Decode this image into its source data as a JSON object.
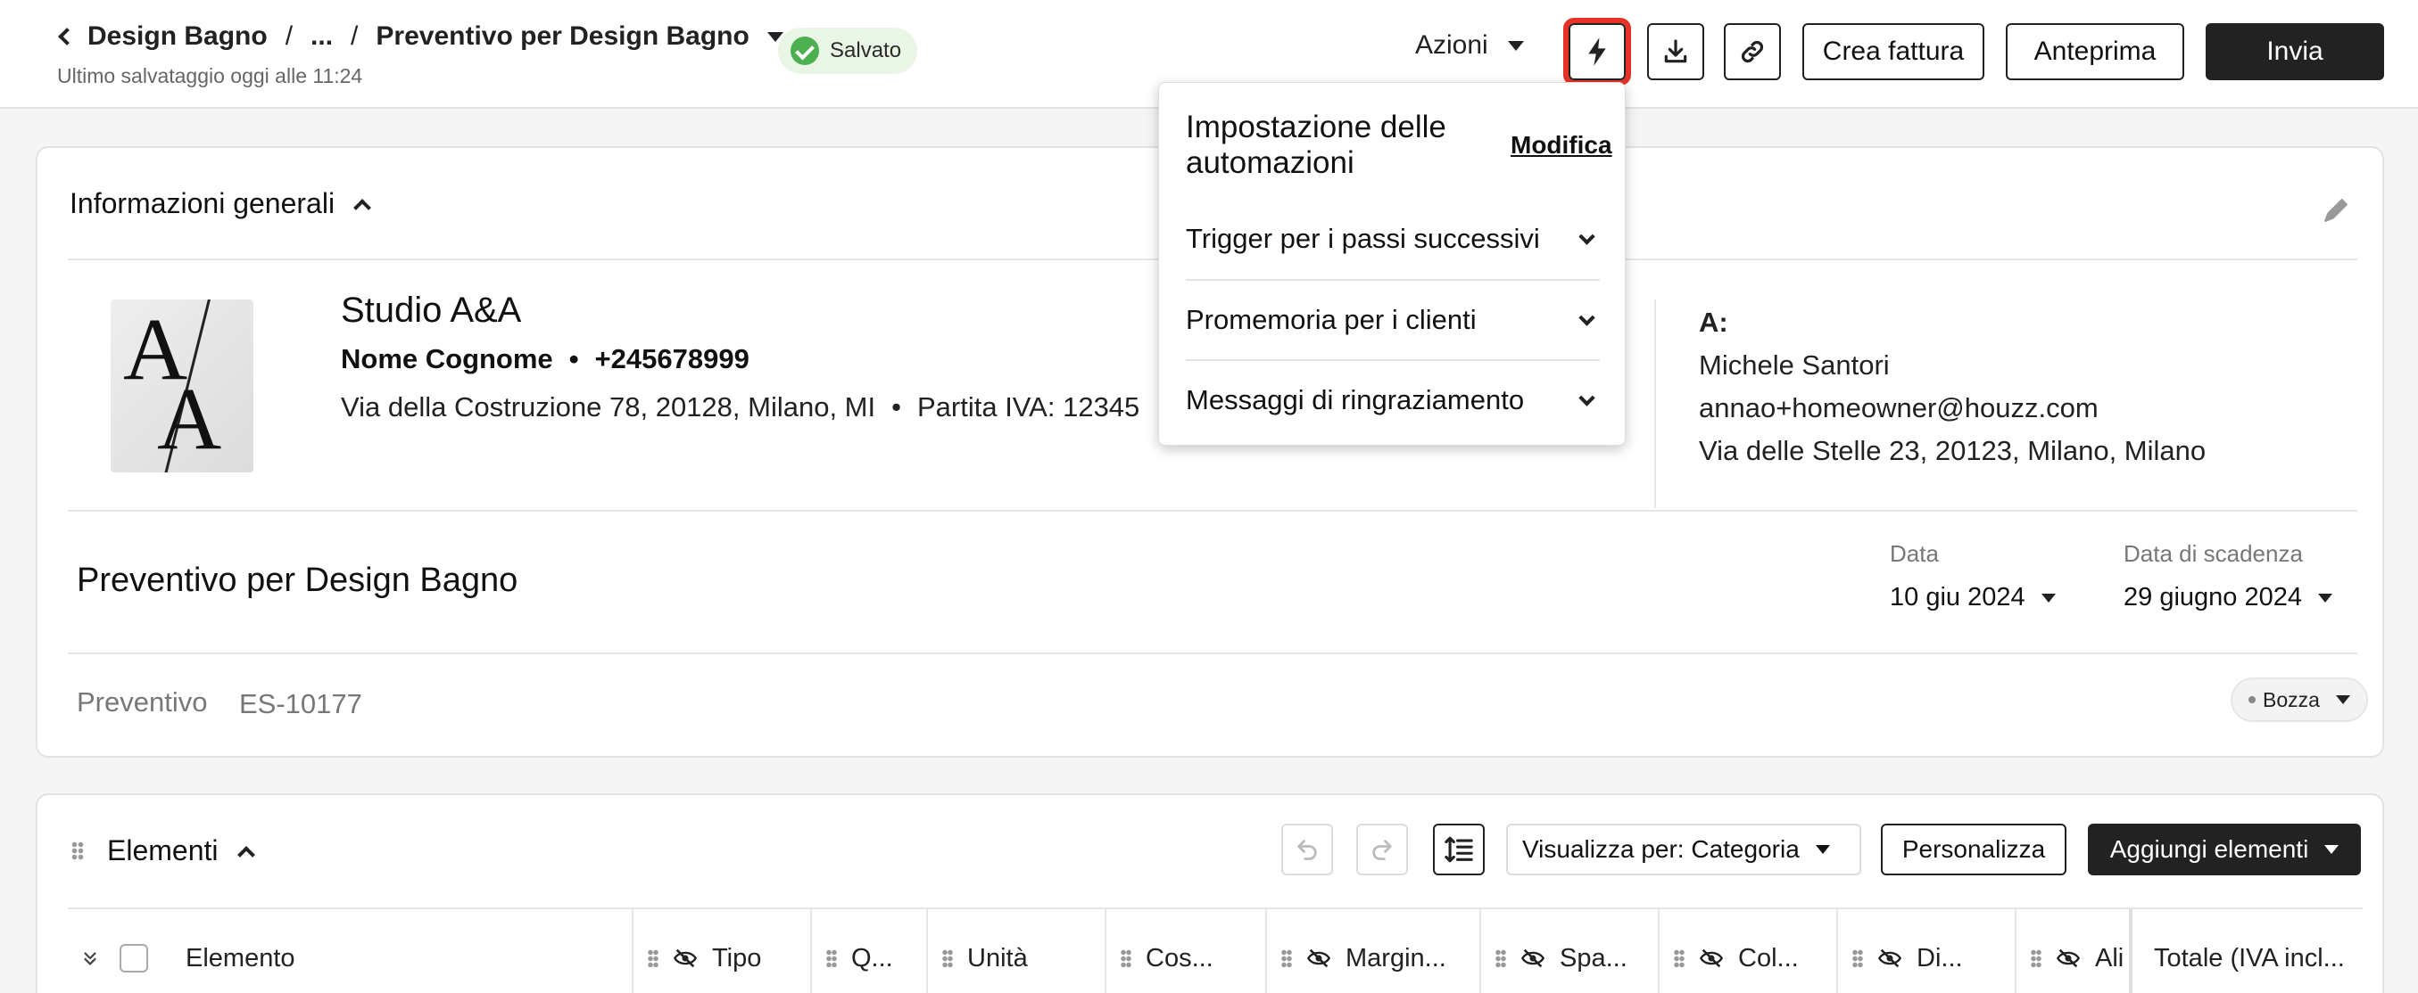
{
  "header": {
    "breadcrumb": {
      "parent": "Design Bagno",
      "ellipsis": "...",
      "current": "Preventivo per Design Bagno"
    },
    "last_saved": "Ultimo salvataggio oggi alle 11:24",
    "saved_badge": "Salvato",
    "actions_label": "Azioni",
    "buttons": {
      "create_invoice": "Crea fattura",
      "preview": "Anteprima",
      "send": "Invia"
    },
    "icons": [
      "lightning-icon",
      "download-icon",
      "link-icon"
    ]
  },
  "automation_menu": {
    "title": "Impostazione delle automazioni",
    "edit": "Modifica",
    "items": [
      "Trigger per i passi successivi",
      "Promemoria per i clienti",
      "Messaggi di ringraziamento"
    ]
  },
  "general_info": {
    "title": "Informazioni generali",
    "company": {
      "name": "Studio A&A",
      "contact_name": "Nome Cognome",
      "phone": "+245678999",
      "address": "Via della Costruzione 78, 20128, Milano, MI",
      "vat": "Partita IVA: 12345"
    },
    "client": {
      "to_label": "A:",
      "name": "Michele Santori",
      "email": "annao+homeowner@houzz.com",
      "address": "Via delle Stelle 23, 20123, Milano, Milano"
    },
    "document_title": "Preventivo per Design Bagno",
    "date_label": "Data",
    "date_value": "10 giu 2024",
    "due_label": "Data di scadenza",
    "due_value": "29 giugno 2024",
    "estimate_label": "Preventivo",
    "estimate_number": "ES-10177",
    "status": "Bozza",
    "logo_letters": "A/A"
  },
  "elements": {
    "title": "Elementi",
    "view_by": "Visualizza per: Categoria",
    "customize": "Personalizza",
    "add_items": "Aggiungi elementi",
    "columns": [
      "Elemento",
      "Tipo",
      "Q...",
      "Unità",
      "Cos...",
      "Margin...",
      "Spa...",
      "Col...",
      "Di...",
      "Ali",
      "Totale (IVA incl..."
    ]
  },
  "colors": {
    "accent_highlight": "#e53327",
    "primary_dark": "#222222",
    "saved_green": "#4caf50"
  }
}
